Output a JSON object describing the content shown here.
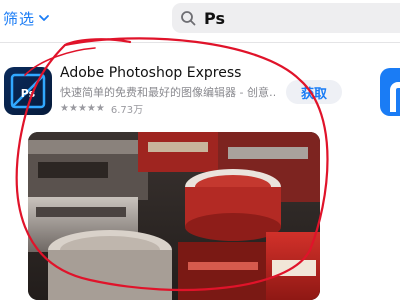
{
  "toolbar": {
    "filter_label": "筛选",
    "search_query": "Ps"
  },
  "result": {
    "app_name": "Adobe Photoshop Express",
    "subtitle": "快速简单的免费和最好的图像编辑器 - 创意…",
    "star_count": 5,
    "rating_count": "6.73万",
    "get_label": "获取",
    "icon_text": "Ps"
  },
  "colors": {
    "accent": "#1a7cf5",
    "annotation": "#e0132a"
  }
}
